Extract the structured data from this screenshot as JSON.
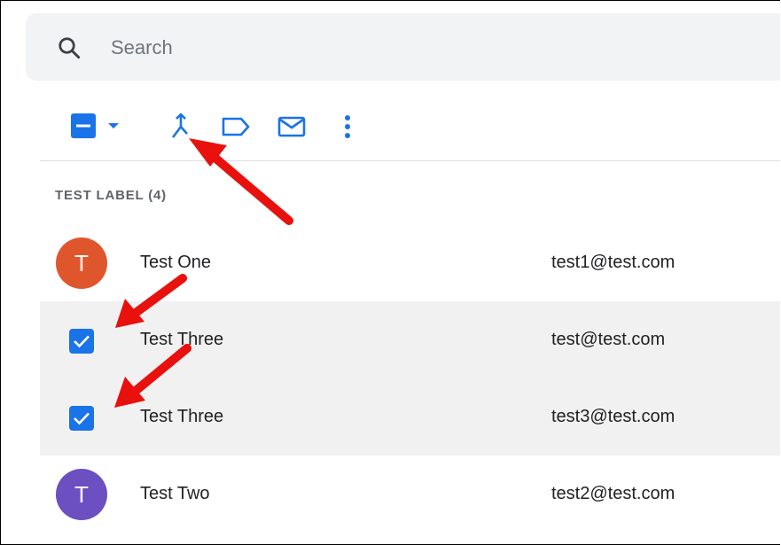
{
  "search": {
    "placeholder": "Search",
    "icon": "search-icon"
  },
  "toolbar": {
    "items": [
      {
        "name": "select-all-checkbox",
        "icon": "minus-square-icon"
      },
      {
        "name": "select-dropdown",
        "icon": "caret-down-icon"
      },
      {
        "name": "merge-button",
        "icon": "merge-icon"
      },
      {
        "name": "label-button",
        "icon": "label-icon"
      },
      {
        "name": "email-button",
        "icon": "mail-icon"
      },
      {
        "name": "more-button",
        "icon": "more-vert-icon"
      }
    ],
    "accent": "#1a73e8"
  },
  "section": {
    "label": "TEST LABEL (4)"
  },
  "contacts": [
    {
      "name": "Test One",
      "email": "test1@test.com",
      "avatar_letter": "T",
      "avatar_color": "#e0562c",
      "selected": false
    },
    {
      "name": "Test Three",
      "email": "test@test.com",
      "avatar_letter": "",
      "avatar_color": "",
      "selected": true
    },
    {
      "name": "Test Three",
      "email": "test3@test.com",
      "avatar_letter": "",
      "avatar_color": "",
      "selected": true
    },
    {
      "name": "Test Two",
      "email": "test2@test.com",
      "avatar_letter": "T",
      "avatar_color": "#6c4fc0",
      "selected": false
    }
  ],
  "annotation_color": "#e8110d"
}
